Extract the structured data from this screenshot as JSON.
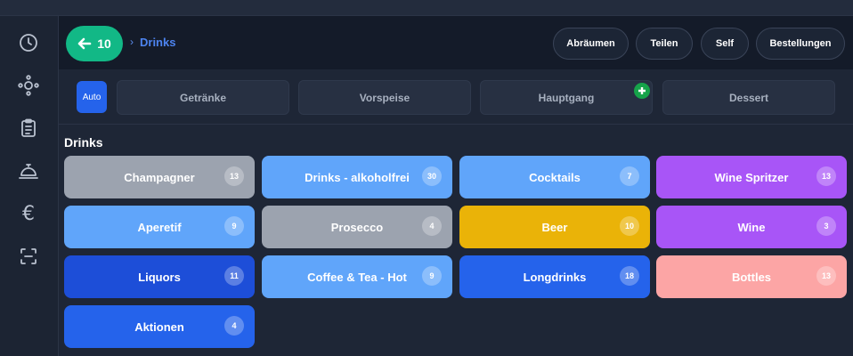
{
  "header": {
    "back_count": "10",
    "breadcrumb_sep": "›",
    "breadcrumb": "Drinks",
    "buttons": [
      "Abräumen",
      "Teilen",
      "Self",
      "Bestellungen"
    ]
  },
  "courses": {
    "auto_label": "Auto",
    "items": [
      "Getränke",
      "Vorspeise",
      "Hauptgang",
      "Dessert"
    ]
  },
  "section": {
    "title": "Drinks"
  },
  "categories": [
    {
      "label": "Champagner",
      "count": "13",
      "color": "#9ca3af"
    },
    {
      "label": "Drinks - alkoholfrei",
      "count": "30",
      "color": "#60a5fa"
    },
    {
      "label": "Cocktails",
      "count": "7",
      "color": "#60a5fa"
    },
    {
      "label": "Wine Spritzer",
      "count": "13",
      "color": "#a855f7"
    },
    {
      "label": "Aperetif",
      "count": "9",
      "color": "#60a5fa"
    },
    {
      "label": "Prosecco",
      "count": "4",
      "color": "#9ca3af"
    },
    {
      "label": "Beer",
      "count": "10",
      "color": "#eab308"
    },
    {
      "label": "Wine",
      "count": "3",
      "color": "#a855f7"
    },
    {
      "label": "Liquors",
      "count": "11",
      "color": "#1d4ed8"
    },
    {
      "label": "Coffee & Tea - Hot",
      "count": "9",
      "color": "#60a5fa"
    },
    {
      "label": "Longdrinks",
      "count": "18",
      "color": "#2563eb"
    },
    {
      "label": "Bottles",
      "count": "13",
      "color": "#fca5a5"
    },
    {
      "label": "Aktionen",
      "count": "4",
      "color": "#2563eb"
    }
  ]
}
